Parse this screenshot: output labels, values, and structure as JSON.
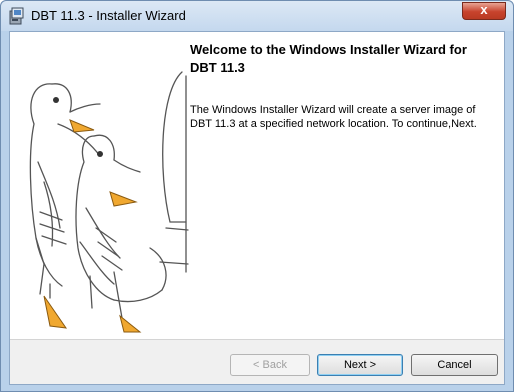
{
  "window": {
    "title": "DBT 11.3 - Installer Wizard",
    "close_glyph": "x"
  },
  "content": {
    "heading": "Welcome to the Windows Installer Wizard for DBT 11.3",
    "description": "The Windows Installer Wizard will create a server image of DBT 11.3 at a specified network location. To continue,Next."
  },
  "buttons": {
    "back": "< Back",
    "next": "Next >",
    "cancel": "Cancel"
  },
  "state": {
    "back_enabled": false
  }
}
